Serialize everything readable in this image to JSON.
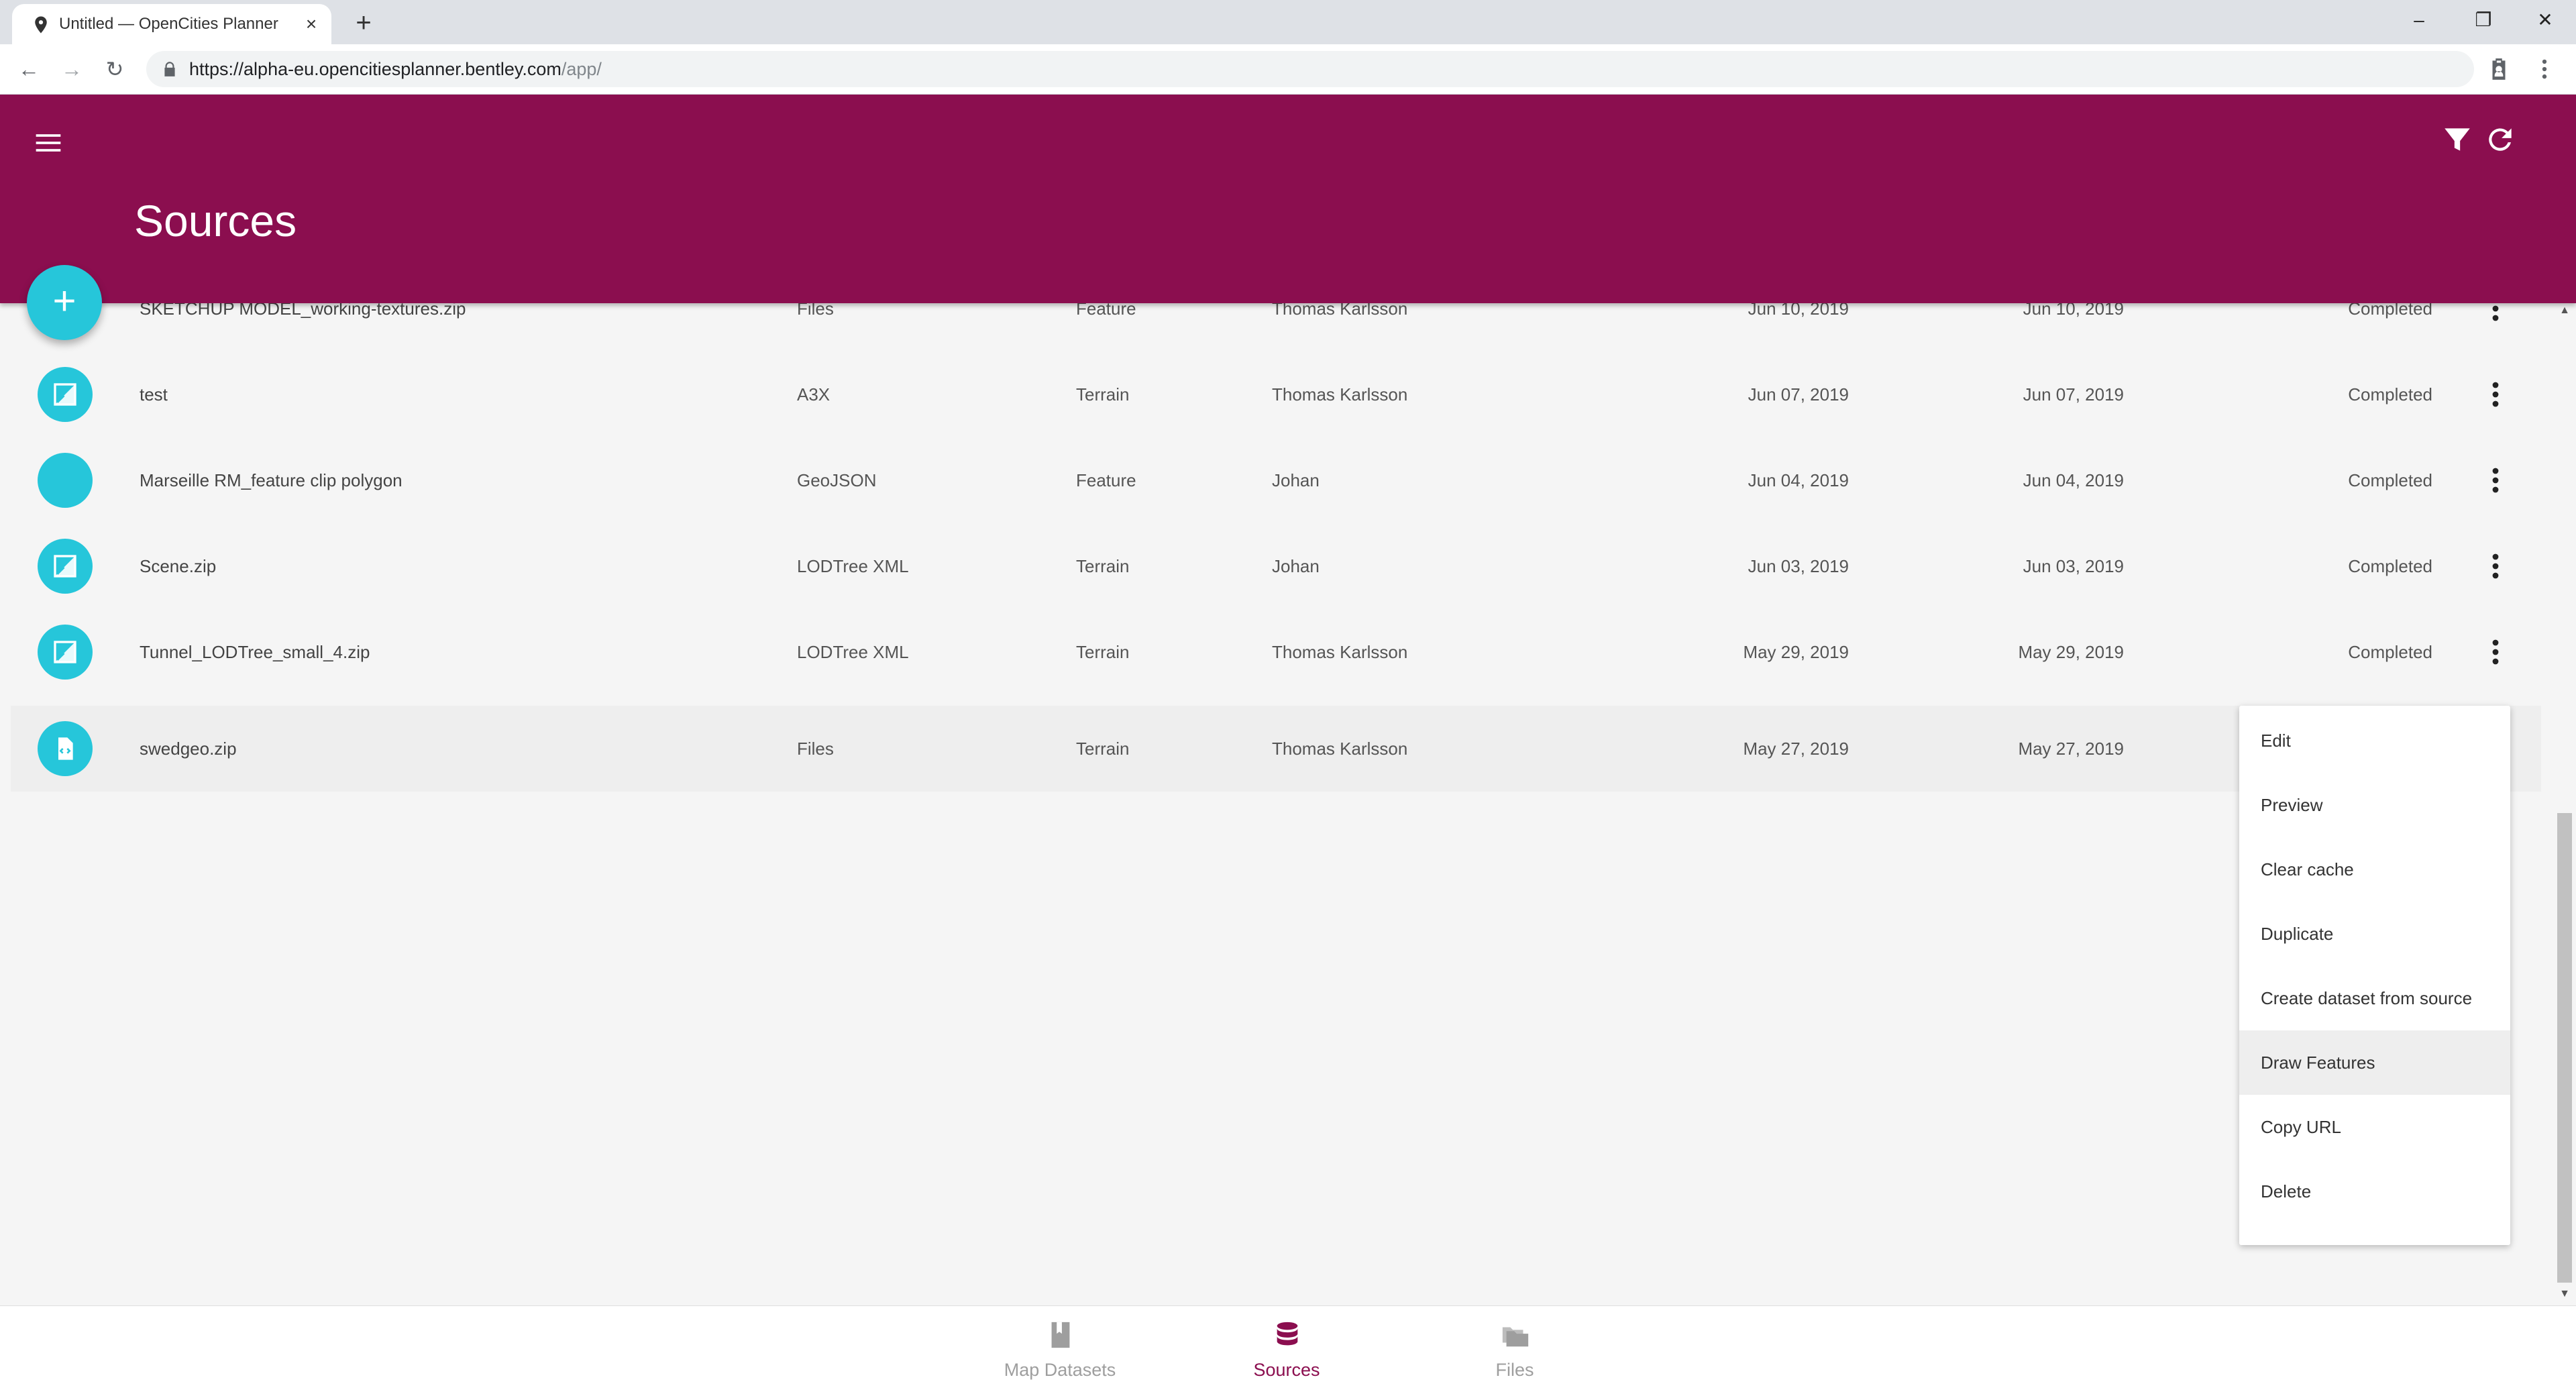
{
  "browser": {
    "tab_title": "Untitled — OpenCities Planner",
    "url_host": "https://alpha-eu.opencitiesplanner.bentley.com",
    "url_path": "/app/"
  },
  "header": {
    "title": "Sources"
  },
  "rows": [
    {
      "name": "SKETCHUP MODEL_working-textures.zip",
      "type": "Files",
      "kind": "Feature",
      "owner": "Thomas Karlsson",
      "created": "Jun 10, 2019",
      "modified": "Jun 10, 2019",
      "status": "Completed",
      "icon": "file-icon"
    },
    {
      "name": "test",
      "type": "A3X",
      "kind": "Terrain",
      "owner": "Thomas Karlsson",
      "created": "Jun 07, 2019",
      "modified": "Jun 07, 2019",
      "status": "Completed",
      "icon": "terrain-icon"
    },
    {
      "name": "Marseille RM_feature clip polygon",
      "type": "GeoJSON",
      "kind": "Feature",
      "owner": "Johan",
      "created": "Jun 04, 2019",
      "modified": "Jun 04, 2019",
      "status": "Completed",
      "icon": "blank-icon"
    },
    {
      "name": "Scene.zip",
      "type": "LODTree XML",
      "kind": "Terrain",
      "owner": "Johan",
      "created": "Jun 03, 2019",
      "modified": "Jun 03, 2019",
      "status": "Completed",
      "icon": "terrain-icon"
    },
    {
      "name": "Tunnel_LODTree_small_4.zip",
      "type": "LODTree XML",
      "kind": "Terrain",
      "owner": "Thomas Karlsson",
      "created": "May 29, 2019",
      "modified": "May 29, 2019",
      "status": "Completed",
      "icon": "terrain-icon"
    },
    {
      "name": "swedgeo.zip",
      "type": "Files",
      "kind": "Terrain",
      "owner": "Thomas Karlsson",
      "created": "May 27, 2019",
      "modified": "May 27, 2019",
      "status": "",
      "icon": "code-file-icon"
    }
  ],
  "context_menu": {
    "items": [
      "Edit",
      "Preview",
      "Clear cache",
      "Duplicate",
      "Create dataset from source",
      "Draw Features",
      "Copy URL",
      "Delete"
    ],
    "hovered": "Draw Features"
  },
  "bottom_nav": {
    "items": [
      {
        "label": "Map Datasets",
        "icon": "book-icon"
      },
      {
        "label": "Sources",
        "icon": "database-icon"
      },
      {
        "label": "Files",
        "icon": "folders-icon"
      }
    ],
    "active": "Sources"
  },
  "colors": {
    "header": "#8b0e4f",
    "accent": "#26c6da",
    "active_nav": "#8b0e4f"
  }
}
